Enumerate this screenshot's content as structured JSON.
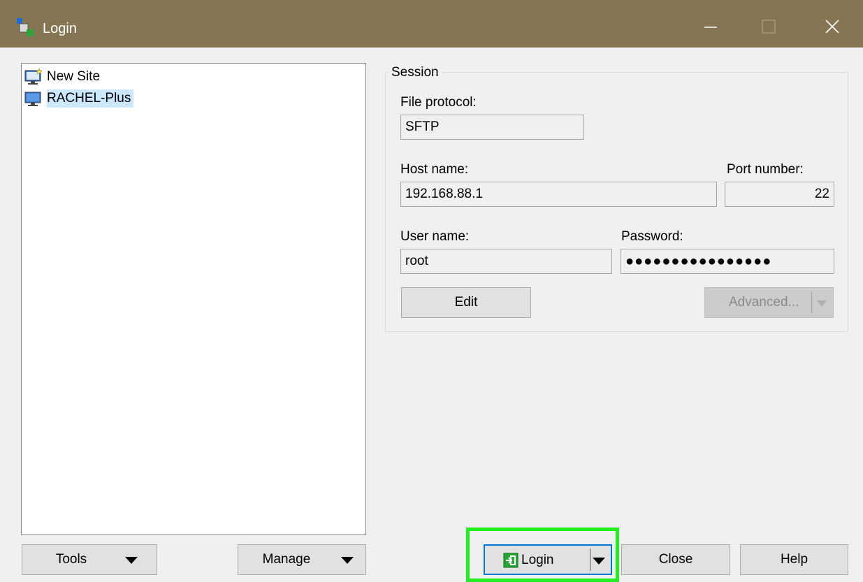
{
  "window": {
    "title": "Login",
    "title_icon": "winscp-login-icon",
    "controls": {
      "minimize": "minimize-icon",
      "maximize": "maximize-icon",
      "close": "close-icon"
    }
  },
  "site_tree": {
    "items": [
      {
        "label": "New Site",
        "icon": "new-site-icon",
        "selected": false
      },
      {
        "label": "RACHEL-Plus",
        "icon": "computer-site-icon",
        "selected": true
      }
    ]
  },
  "session": {
    "group_label": "Session",
    "file_protocol": {
      "label": "File protocol:",
      "value": "SFTP"
    },
    "host_name": {
      "label": "Host name:",
      "value": "192.168.88.1"
    },
    "port_number": {
      "label": "Port number:",
      "value": "22"
    },
    "user_name": {
      "label": "User name:",
      "value": "root"
    },
    "password": {
      "label": "Password:",
      "value": "●●●●●●●●●●●●●●●●"
    },
    "edit_button": "Edit",
    "advanced_button": "Advanced..."
  },
  "bottom_bar": {
    "tools": "Tools",
    "manage": "Manage",
    "login": "Login",
    "close": "Close",
    "help": "Help"
  },
  "colors": {
    "titlebar": "#857553",
    "selection": "#cce8ff",
    "highlight": "#22ee22",
    "default_button_border": "#0078d7"
  }
}
